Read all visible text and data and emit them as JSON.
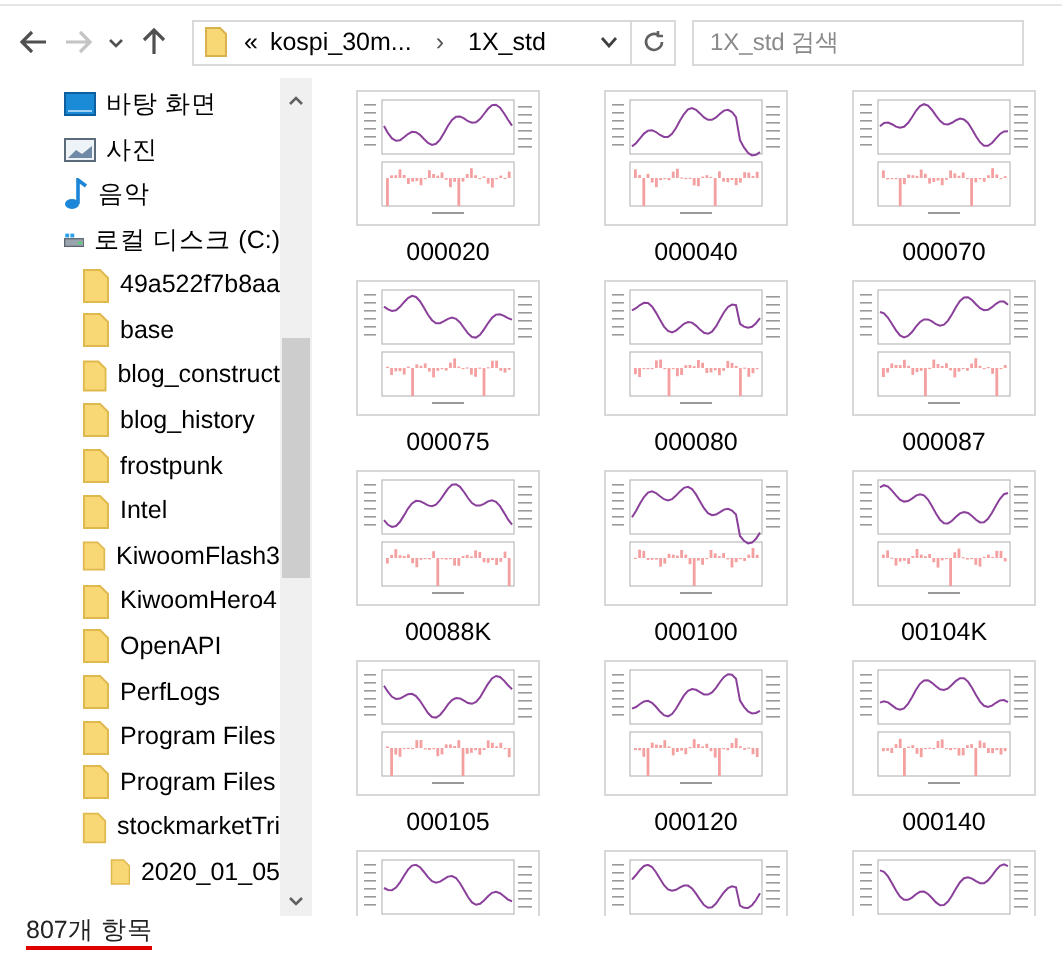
{
  "toolbar": {
    "back": {
      "disabled": false
    },
    "forward": {
      "disabled": true
    },
    "address": {
      "overflow": "«",
      "breadcrumbs": [
        "kospi_30m...",
        "1X_std"
      ],
      "separator": "›"
    },
    "search": {
      "placeholder": "1X_std 검색"
    }
  },
  "nav": {
    "items": [
      {
        "label": "바탕 화면",
        "kind": "desktop"
      },
      {
        "label": "사진",
        "kind": "pictures"
      },
      {
        "label": "음악",
        "kind": "music"
      },
      {
        "label": "로컬 디스크 (C:)",
        "kind": "drive",
        "children": [
          {
            "label": "49a522f7b8aa",
            "kind": "folder"
          },
          {
            "label": "base",
            "kind": "folder"
          },
          {
            "label": "blog_construct",
            "kind": "folder"
          },
          {
            "label": "blog_history",
            "kind": "folder"
          },
          {
            "label": "frostpunk",
            "kind": "folder"
          },
          {
            "label": "Intel",
            "kind": "folder"
          },
          {
            "label": "KiwoomFlash3",
            "kind": "folder"
          },
          {
            "label": "KiwoomHero4",
            "kind": "folder"
          },
          {
            "label": "OpenAPI",
            "kind": "folder"
          },
          {
            "label": "PerfLogs",
            "kind": "folder"
          },
          {
            "label": "Program Files",
            "kind": "folder"
          },
          {
            "label": "Program Files",
            "kind": "folder"
          },
          {
            "label": "stockmarketTri",
            "kind": "folder",
            "children": [
              {
                "label": "2020_01_05",
                "kind": "folder"
              }
            ]
          }
        ]
      }
    ]
  },
  "files": [
    {
      "name": "000020",
      "kind": "image"
    },
    {
      "name": "000040",
      "kind": "image"
    },
    {
      "name": "000070",
      "kind": "image"
    },
    {
      "name": "000075",
      "kind": "image"
    },
    {
      "name": "000080",
      "kind": "image"
    },
    {
      "name": "000087",
      "kind": "image"
    },
    {
      "name": "00088K",
      "kind": "image"
    },
    {
      "name": "000100",
      "kind": "image"
    },
    {
      "name": "00104K",
      "kind": "image"
    },
    {
      "name": "000105",
      "kind": "image"
    },
    {
      "name": "000120",
      "kind": "image"
    },
    {
      "name": "000140",
      "kind": "image"
    },
    {
      "kind": "image"
    },
    {
      "kind": "image"
    },
    {
      "kind": "image"
    }
  ],
  "status_bar": {
    "count": "807개 항목"
  }
}
